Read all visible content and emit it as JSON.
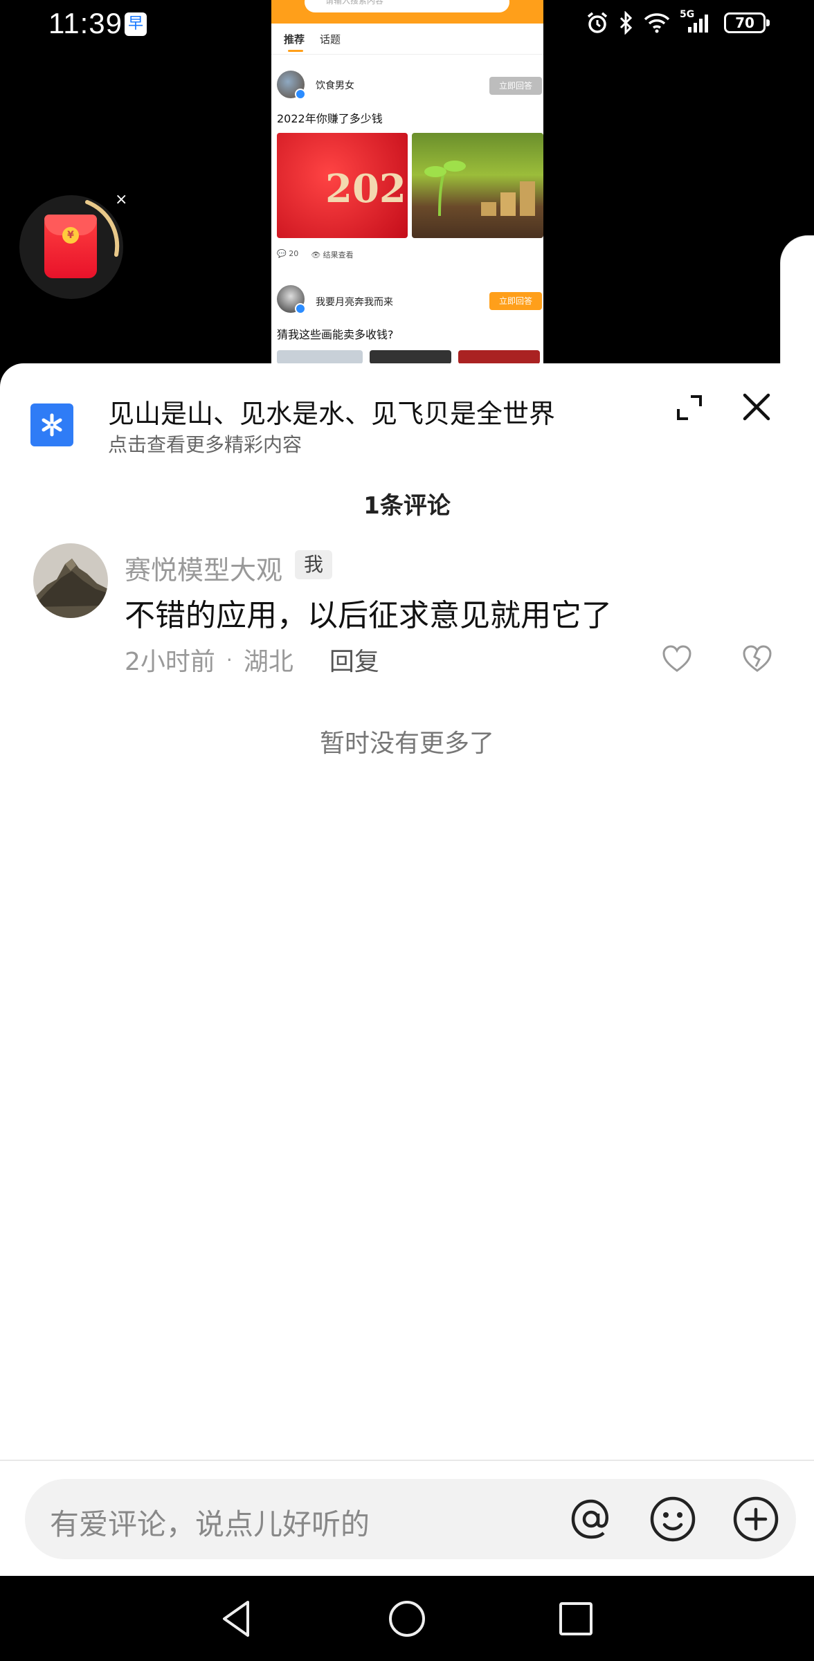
{
  "status_bar": {
    "time": "11:39",
    "notification_glyph": "早",
    "network": "5G",
    "battery": "70"
  },
  "background_app": {
    "search_placeholder": "请输入搜索内容",
    "tabs": [
      "推荐",
      "话题"
    ],
    "posts": [
      {
        "user": "饮食男女",
        "answer_label": "立即回答",
        "question": "2022年你赚了多少钱",
        "image_text": "202",
        "comments": "20",
        "views_label": "结果查看"
      },
      {
        "user": "我要月亮奔我而来",
        "answer_label": "立即回答",
        "question": "猜我这些画能卖多收钱?"
      }
    ],
    "accent_color": "#ff9f1a"
  },
  "floating_widget": {
    "coin_symbol": "¥",
    "close": "×"
  },
  "sheet": {
    "title": "见山是山、见水是水、见飞贝是全世界",
    "subtitle": "点击查看更多精彩内容",
    "comment_count_title": "1条评论",
    "comments": [
      {
        "user": "赛悦模型大观",
        "badge": "我",
        "text": "不错的应用，以后征求意见就用它了",
        "time": "2小时前",
        "location": "湖北",
        "reply_label": "回复"
      }
    ],
    "no_more": "暂时没有更多了",
    "input_placeholder": "有爱评论，说点儿好听的"
  },
  "icons": {
    "expand": "expand-icon",
    "close": "close-icon",
    "like": "heart-icon",
    "dislike": "broken-heart-icon",
    "at": "at-icon",
    "emoji": "smiley-icon",
    "plus": "plus-icon",
    "back": "back-triangle-icon",
    "home": "home-circle-icon",
    "recents": "recents-square-icon"
  }
}
